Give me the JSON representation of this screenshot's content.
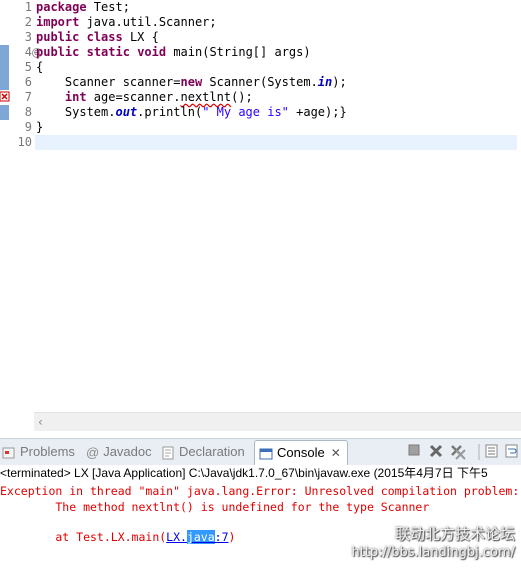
{
  "editor": {
    "line_numbers": [
      "1",
      "2",
      "3",
      "4",
      "5",
      "6",
      "7",
      "8",
      "9",
      "10"
    ],
    "lines": {
      "l1": {
        "kw": "package",
        "rest": " Test;"
      },
      "l2": {
        "kw": "import",
        "rest": " java.util.Scanner;"
      },
      "l3": {
        "kw1": "public",
        "kw2": "class",
        "rest": " LX {"
      },
      "l4": {
        "kw1": "public",
        "kw2": "static",
        "kw3": "void",
        "rest": " main(String[] args)"
      },
      "l5": {
        "text": "{"
      },
      "l6": {
        "a": "    Scanner scanner=",
        "kw": "new",
        "b": " Scanner(System.",
        "fld": "in",
        "c": ");"
      },
      "l7": {
        "kw": "    int",
        "a": " age=scanner.",
        "err": "nextlnt",
        "b": "();"
      },
      "l8": {
        "a": "    System.",
        "fld": "out",
        "b": ".println(",
        "str": "\" My age is\"",
        "c": " +age);}"
      },
      "l9": {
        "text": "}"
      },
      "l10": {
        "text": ""
      }
    },
    "fold_symbol": "⊖",
    "scroll_left_arrow": "‹"
  },
  "tabs": {
    "problems": "Problems",
    "javadoc": "Javadoc",
    "declaration": "Declaration",
    "console": "Console",
    "close": "✕"
  },
  "console": {
    "header": "<terminated> LX [Java Application] C:\\Java\\jdk1.7.0_67\\bin\\javaw.exe (2015年4月7日 下午5",
    "error1": "Exception in thread \"main\" java.lang.Error: Unresolved compilation problem:",
    "error2": "        The method nextlnt() is undefined for the type Scanner",
    "trace_prefix": "        at Test.LX.main(",
    "link_a": "LX.",
    "link_sel": "java",
    "link_b": ":7",
    "trace_suffix": ")"
  },
  "watermark": {
    "cn": "联动北方技术论坛",
    "url": "http://bbs.landingbj.com/"
  },
  "colors": {
    "keyword": "#7f0055",
    "field": "#0000c0",
    "string": "#2a00ff",
    "error": "#e00000",
    "current_line": "#e8f2fe"
  }
}
